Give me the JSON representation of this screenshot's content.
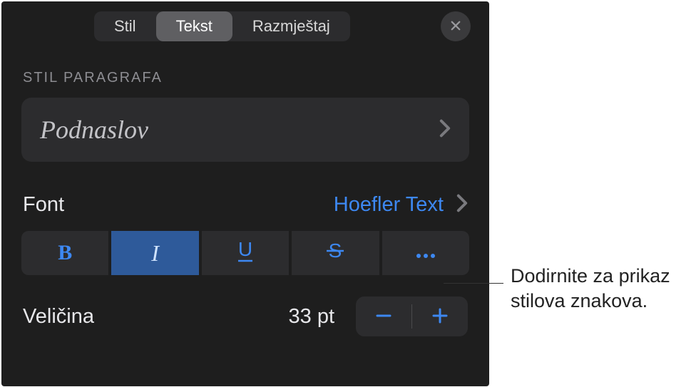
{
  "tabs": {
    "stil": "Stil",
    "tekst": "Tekst",
    "razmjestaj": "Razmještaj"
  },
  "section": {
    "paragraph_style_label": "STIL PARAGRAFA",
    "paragraph_style_value": "Podnaslov"
  },
  "font": {
    "label": "Font",
    "value": "Hoefler Text"
  },
  "format_buttons": {
    "bold": "B",
    "italic": "I",
    "underline": "U",
    "strikethrough": "S",
    "more": "•••"
  },
  "size": {
    "label": "Veličina",
    "value": "33 pt"
  },
  "callout": {
    "text": "Dodirnite za prikaz stilova znakova."
  },
  "colors": {
    "accent": "#3d88f2",
    "panel_bg": "#1e1e1e",
    "control_bg": "#2c2c2e"
  }
}
